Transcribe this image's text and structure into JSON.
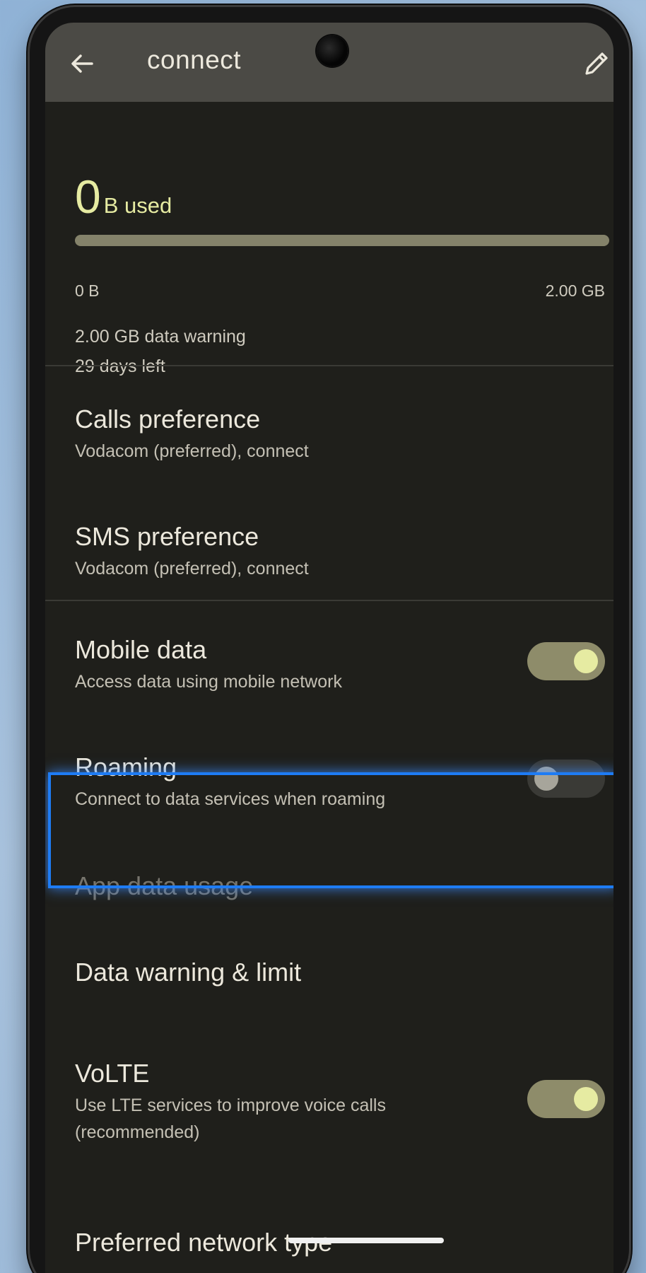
{
  "appbar": {
    "title": "connect"
  },
  "usage": {
    "amount": "0",
    "unit": "B used",
    "fraction_used": 0.0,
    "min_label": "0 B",
    "max_label": "2.00 GB",
    "warning": "2.00 GB data warning",
    "days_left": "29 days left"
  },
  "settings": {
    "calls": {
      "title": "Calls preference",
      "subtitle": "Vodacom (preferred), connect"
    },
    "sms": {
      "title": "SMS preference",
      "subtitle": "Vodacom (preferred), connect"
    },
    "mobile_data": {
      "title": "Mobile data",
      "subtitle": "Access data using mobile network",
      "enabled": true
    },
    "roaming": {
      "title": "Roaming",
      "subtitle": "Connect to data services when roaming",
      "enabled": false
    },
    "app_data_usage": {
      "title": "App data usage"
    },
    "data_warning": {
      "title": "Data warning & limit"
    },
    "volte": {
      "title": "VoLTE",
      "subtitle_line1": "Use LTE services to improve voice calls",
      "subtitle_line2": "(recommended)",
      "enabled": true
    },
    "preferred_network": {
      "title": "Preferred network type"
    }
  },
  "colors": {
    "accent": "#e6eba2",
    "highlight": "#1e7cf5",
    "background": "#1f1f1b"
  }
}
